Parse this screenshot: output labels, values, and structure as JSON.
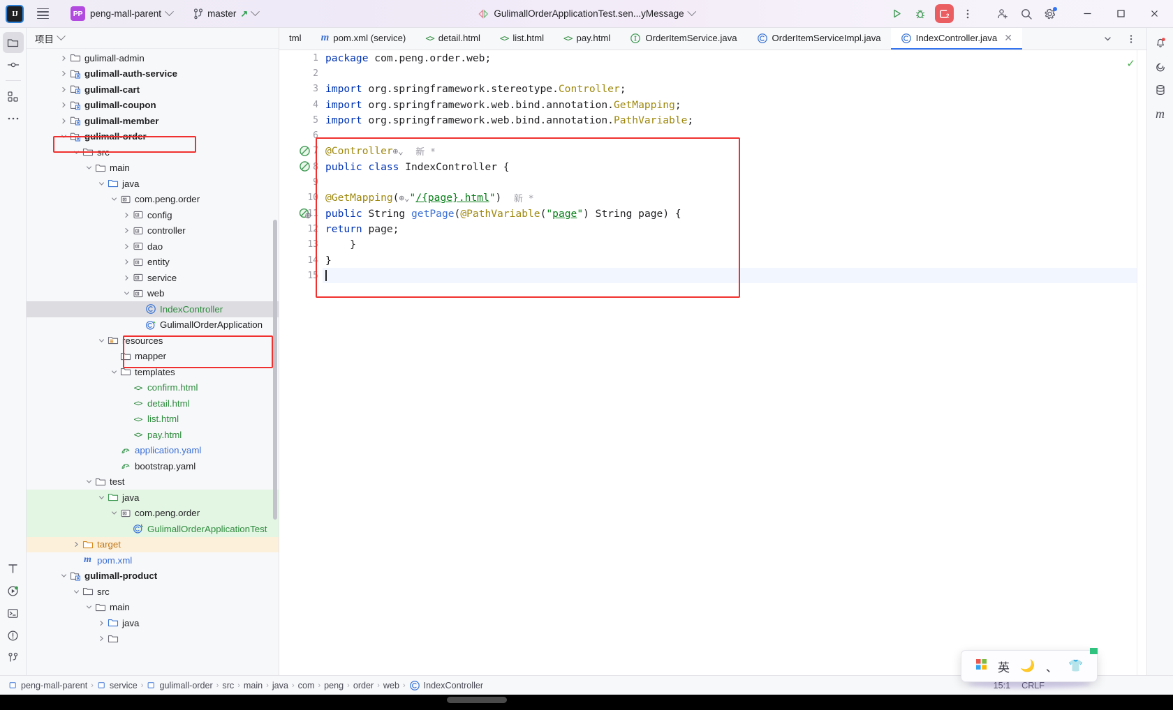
{
  "titlebar": {
    "logo": "IJ",
    "project_badge": "PP",
    "project_name": "peng-mall-parent",
    "branch": "master",
    "run_config": "GulimallOrderApplicationTest.sen...yMessage",
    "icons": {
      "menu": "hamburger-icon",
      "vcs": "branch-icon",
      "run": "run-icon",
      "debug": "debug-icon",
      "stop": "stop-icon",
      "more": "more-vertical-icon",
      "share": "add-user-icon",
      "search": "search-icon",
      "settings": "gear-icon",
      "minimize": "─",
      "maximize": "☐",
      "close": "✕"
    }
  },
  "left_rail": [
    {
      "name": "project",
      "icon": "folder-icon",
      "active": true
    },
    {
      "name": "commit",
      "icon": "commit-icon",
      "active": false
    },
    {
      "name": "structure",
      "icon": "structure-icon",
      "active": false
    },
    {
      "name": "more-tool-windows",
      "icon": "ellipsis-icon",
      "active": false
    }
  ],
  "left_rail_bottom": [
    {
      "name": "database",
      "icon": "letter-t-icon"
    },
    {
      "name": "run",
      "icon": "play-circle-icon"
    },
    {
      "name": "terminal",
      "icon": "terminal-icon"
    },
    {
      "name": "problems",
      "icon": "warning-icon"
    },
    {
      "name": "version-control",
      "icon": "git-icon"
    }
  ],
  "right_rail": [
    {
      "name": "notifications",
      "icon": "bell-icon",
      "badge": true
    },
    {
      "name": "ai-assistant",
      "icon": "spiral-icon"
    },
    {
      "name": "database",
      "icon": "database-icon"
    },
    {
      "name": "maven",
      "icon": "maven-m-icon"
    }
  ],
  "project_panel": {
    "title": "项目",
    "tree": [
      {
        "depth": 2,
        "twisty": "collapsed",
        "icon": "folder-plain",
        "label": "gulimall-admin",
        "bold": false,
        "color": "default"
      },
      {
        "depth": 2,
        "twisty": "collapsed",
        "icon": "module",
        "label": "gulimall-auth-service",
        "bold": true,
        "color": "default"
      },
      {
        "depth": 2,
        "twisty": "collapsed",
        "icon": "module",
        "label": "gulimall-cart",
        "bold": true,
        "color": "default"
      },
      {
        "depth": 2,
        "twisty": "collapsed",
        "icon": "module",
        "label": "gulimall-coupon",
        "bold": true,
        "color": "default"
      },
      {
        "depth": 2,
        "twisty": "collapsed",
        "icon": "module",
        "label": "gulimall-member",
        "bold": true,
        "color": "default"
      },
      {
        "depth": 2,
        "twisty": "expanded",
        "icon": "module",
        "label": "gulimall-order",
        "bold": true,
        "color": "default",
        "highlight": "red-box"
      },
      {
        "depth": 3,
        "twisty": "expanded",
        "icon": "folder-plain",
        "label": "src",
        "bold": false,
        "color": "default"
      },
      {
        "depth": 4,
        "twisty": "expanded",
        "icon": "folder-plain",
        "label": "main",
        "bold": false,
        "color": "default"
      },
      {
        "depth": 5,
        "twisty": "expanded",
        "icon": "folder-source",
        "label": "java",
        "bold": false,
        "color": "default"
      },
      {
        "depth": 6,
        "twisty": "expanded",
        "icon": "package",
        "label": "com.peng.order",
        "bold": false,
        "color": "default"
      },
      {
        "depth": 7,
        "twisty": "collapsed",
        "icon": "package",
        "label": "config",
        "bold": false,
        "color": "default"
      },
      {
        "depth": 7,
        "twisty": "collapsed",
        "icon": "package",
        "label": "controller",
        "bold": false,
        "color": "default"
      },
      {
        "depth": 7,
        "twisty": "collapsed",
        "icon": "package",
        "label": "dao",
        "bold": false,
        "color": "default"
      },
      {
        "depth": 7,
        "twisty": "collapsed",
        "icon": "package",
        "label": "entity",
        "bold": false,
        "color": "default"
      },
      {
        "depth": 7,
        "twisty": "collapsed",
        "icon": "package",
        "label": "service",
        "bold": false,
        "color": "default"
      },
      {
        "depth": 7,
        "twisty": "expanded",
        "icon": "package",
        "label": "web",
        "bold": false,
        "color": "default"
      },
      {
        "depth": 8,
        "twisty": "none",
        "icon": "class",
        "label": "IndexController",
        "bold": false,
        "color": "green",
        "selected": true
      },
      {
        "depth": 8,
        "twisty": "none",
        "icon": "spring-class",
        "label": "GulimallOrderApplication",
        "bold": false,
        "color": "default"
      },
      {
        "depth": 5,
        "twisty": "expanded",
        "icon": "folder-resources",
        "label": "resources",
        "bold": false,
        "color": "default"
      },
      {
        "depth": 6,
        "twisty": "none",
        "icon": "folder-plain",
        "label": "mapper",
        "bold": false,
        "color": "default"
      },
      {
        "depth": 6,
        "twisty": "expanded",
        "icon": "folder-plain",
        "label": "templates",
        "bold": false,
        "color": "default"
      },
      {
        "depth": 7,
        "twisty": "none",
        "icon": "html",
        "label": "confirm.html",
        "bold": false,
        "color": "green"
      },
      {
        "depth": 7,
        "twisty": "none",
        "icon": "html",
        "label": "detail.html",
        "bold": false,
        "color": "green"
      },
      {
        "depth": 7,
        "twisty": "none",
        "icon": "html",
        "label": "list.html",
        "bold": false,
        "color": "green"
      },
      {
        "depth": 7,
        "twisty": "none",
        "icon": "html",
        "label": "pay.html",
        "bold": false,
        "color": "green"
      },
      {
        "depth": 6,
        "twisty": "none",
        "icon": "yaml",
        "label": "application.yaml",
        "bold": false,
        "color": "blue"
      },
      {
        "depth": 6,
        "twisty": "none",
        "icon": "yaml",
        "label": "bootstrap.yaml",
        "bold": false,
        "color": "default"
      },
      {
        "depth": 4,
        "twisty": "expanded",
        "icon": "folder-plain",
        "label": "test",
        "bold": false,
        "color": "default"
      },
      {
        "depth": 5,
        "twisty": "expanded",
        "icon": "folder-test",
        "label": "java",
        "bold": false,
        "color": "default",
        "rowbg": "green"
      },
      {
        "depth": 6,
        "twisty": "expanded",
        "icon": "package",
        "label": "com.peng.order",
        "bold": false,
        "color": "default",
        "rowbg": "green"
      },
      {
        "depth": 7,
        "twisty": "none",
        "icon": "test-class",
        "label": "GulimallOrderApplicationTest",
        "bold": false,
        "color": "green",
        "rowbg": "green"
      },
      {
        "depth": 3,
        "twisty": "collapsed",
        "icon": "folder-excluded",
        "label": "target",
        "bold": false,
        "color": "orange",
        "rowbg": "orange"
      },
      {
        "depth": 3,
        "twisty": "none",
        "icon": "maven",
        "label": "pom.xml",
        "bold": false,
        "color": "blue"
      },
      {
        "depth": 2,
        "twisty": "expanded",
        "icon": "module",
        "label": "gulimall-product",
        "bold": true,
        "color": "default"
      },
      {
        "depth": 3,
        "twisty": "expanded",
        "icon": "folder-plain",
        "label": "src",
        "bold": false,
        "color": "default"
      },
      {
        "depth": 4,
        "twisty": "expanded",
        "icon": "folder-plain",
        "label": "main",
        "bold": false,
        "color": "default"
      },
      {
        "depth": 5,
        "twisty": "collapsed",
        "icon": "folder-source",
        "label": "java",
        "bold": false,
        "color": "default"
      },
      {
        "depth": 5,
        "twisty": "collapsed",
        "icon": "folder-plain",
        "label": "",
        "bold": false,
        "color": "default"
      }
    ]
  },
  "editor": {
    "tabs": [
      {
        "label": "tml",
        "icon": "html-icon",
        "icon_color": "#2e8b3d",
        "active": false,
        "partial": true
      },
      {
        "label": "pom.xml (service)",
        "icon": "maven-icon",
        "icon_color": "#3b6fd4",
        "active": false
      },
      {
        "label": "detail.html",
        "icon": "html-icon",
        "icon_color": "#2e8b3d",
        "active": false
      },
      {
        "label": "list.html",
        "icon": "html-icon",
        "icon_color": "#2e8b3d",
        "active": false
      },
      {
        "label": "pay.html",
        "icon": "html-icon",
        "icon_color": "#2e8b3d",
        "active": false
      },
      {
        "label": "OrderItemService.java",
        "icon": "interface-icon",
        "icon_color": "#2e8b3d",
        "active": false
      },
      {
        "label": "OrderItemServiceImpl.java",
        "icon": "class-icon",
        "icon_color": "#3b6fd4",
        "active": false
      },
      {
        "label": "IndexController.java",
        "icon": "class-icon",
        "icon_color": "#3b6fd4",
        "active": true,
        "closable": true
      }
    ],
    "tabs_right_icons": [
      "chevron-down-icon",
      "more-vertical-icon"
    ],
    "inspection_status": "ok-check",
    "lines": [
      {
        "n": 1,
        "html": "<span class=\"kw\">package</span> com.peng.order.web;"
      },
      {
        "n": 2,
        "html": ""
      },
      {
        "n": 3,
        "html": "<span class=\"kw\">import</span> org.springframework.stereotype.<span class=\"cls\">Controller</span>;"
      },
      {
        "n": 4,
        "html": "<span class=\"kw\">import</span> org.springframework.web.bind.annotation.<span class=\"cls\">GetMapping</span>;"
      },
      {
        "n": 5,
        "html": "<span class=\"kw\">import</span> org.springframework.web.bind.annotation.<span class=\"cls\">PathVariable</span>;"
      },
      {
        "n": 6,
        "html": ""
      },
      {
        "n": 7,
        "html": "<span class=\"ann\">@Controller</span><span class=\"globe\">⊕⌄</span>&nbsp;&nbsp;<span class=\"hint\">新 *</span>",
        "gutter_mark": "run-gutter-icon"
      },
      {
        "n": 8,
        "html": "<span class=\"kw\">public class</span> IndexController {",
        "gutter_mark": "run-gutter-icon"
      },
      {
        "n": 9,
        "html": ""
      },
      {
        "n": 10,
        "html": "    <span class=\"ann\">@GetMapping</span>(<span class=\"globe\">⊕⌄</span><span class=\"str\">\"</span><span class=\"ulink\">/{page}.html</span><span class=\"str\">\"</span>)&nbsp;&nbsp;<span class=\"hint\">新 *</span>"
      },
      {
        "n": 11,
        "html": "    <span class=\"kw\">public</span> String <span class=\"meth\">getPage</span>(<span class=\"ann\">@PathVariable</span>(<span class=\"str\">\"</span><span class=\"ulink\">page</span><span class=\"str\">\"</span>) String page) {",
        "gutter_mark": "web-gutter-icon"
      },
      {
        "n": 12,
        "html": "        <span class=\"kw\">return</span> page;"
      },
      {
        "n": 13,
        "html": "    }"
      },
      {
        "n": 14,
        "html": "}"
      },
      {
        "n": 15,
        "html": "<span class=\"caret\"></span>",
        "current": true
      }
    ]
  },
  "statusbar": {
    "breadcrumbs": [
      {
        "label": "peng-mall-parent",
        "icon": "module-icon"
      },
      {
        "label": "service",
        "icon": "module-icon"
      },
      {
        "label": "gulimall-order",
        "icon": "module-icon"
      },
      {
        "label": "src",
        "icon": "none"
      },
      {
        "label": "main",
        "icon": "none"
      },
      {
        "label": "java",
        "icon": "none"
      },
      {
        "label": "com",
        "icon": "none"
      },
      {
        "label": "peng",
        "icon": "none"
      },
      {
        "label": "order",
        "icon": "none"
      },
      {
        "label": "web",
        "icon": "none"
      },
      {
        "label": "IndexController",
        "icon": "class-icon"
      }
    ],
    "separator": "›",
    "caret_position": "15:1",
    "line_separator": "CRLF"
  },
  "ime_popup": {
    "icons": [
      "windows-icon",
      "eng-mode",
      "moon-icon",
      "comma-icon",
      "shirt-icon"
    ],
    "mode_label": "英"
  }
}
